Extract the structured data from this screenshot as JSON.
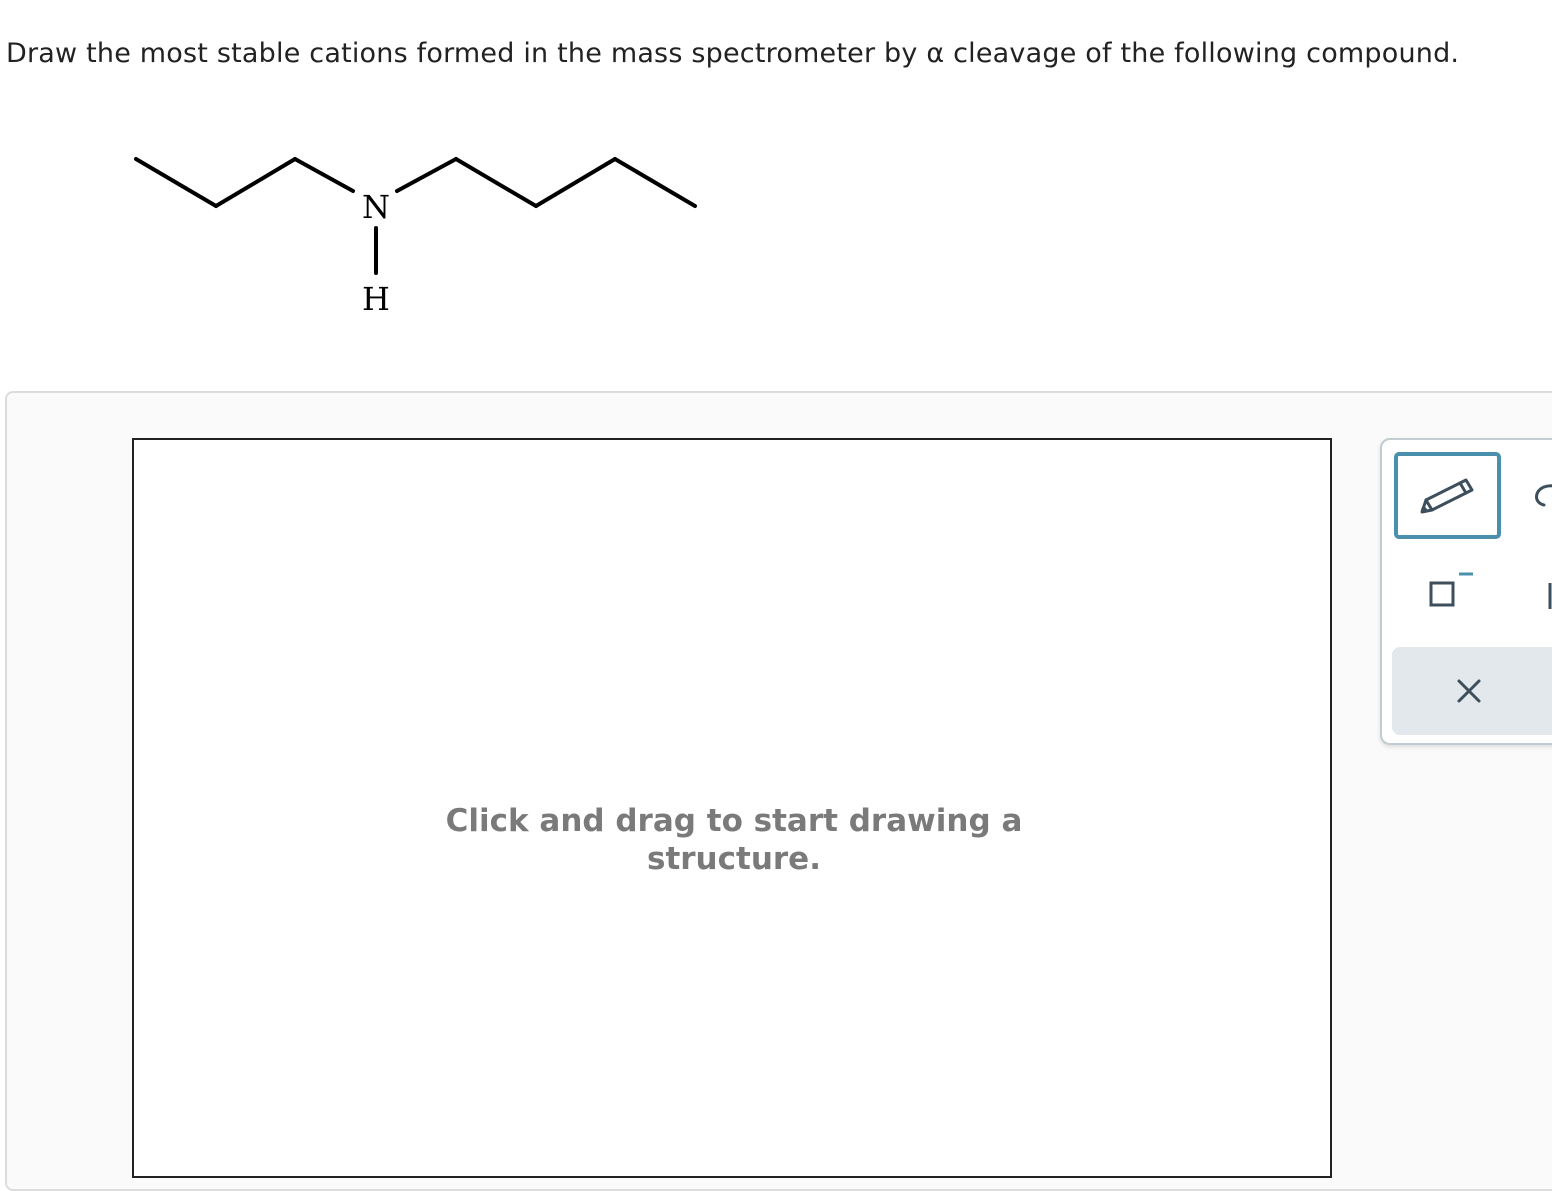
{
  "question": {
    "text": "Draw the most stable cations formed in the mass spectrometer by α cleavage of the following compound."
  },
  "molecule": {
    "atoms": {
      "nitrogen": "N",
      "hydrogen": "H"
    }
  },
  "drawing_canvas": {
    "placeholder": "Click and drag to start drawing a structure."
  },
  "toolbar": {
    "tools": [
      {
        "name": "pencil",
        "icon": "pencil-icon",
        "selected": true
      },
      {
        "name": "lasso",
        "icon": "lasso-icon",
        "selected": false
      },
      {
        "name": "charge",
        "icon": "charge-icon",
        "selected": false
      },
      {
        "name": "clear",
        "icon": "close-icon",
        "selected": false
      }
    ],
    "accent_color": "#4a90ad",
    "clear_button_bg": "#e2e8eb"
  }
}
